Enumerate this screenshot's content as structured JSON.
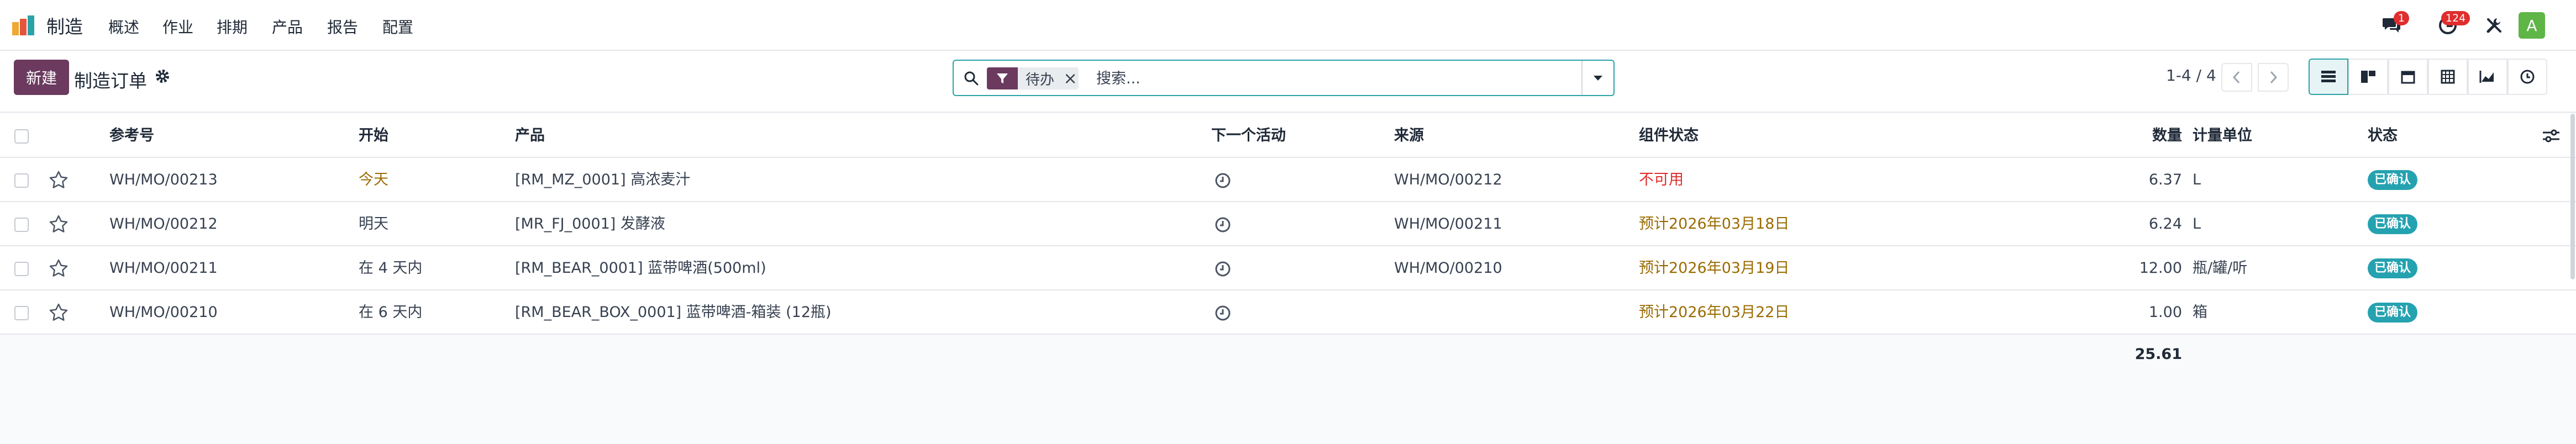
{
  "app": {
    "name": "制造"
  },
  "menu": [
    "概述",
    "作业",
    "排期",
    "产品",
    "报告",
    "配置"
  ],
  "systray": {
    "messages_count": "1",
    "activities_count": "124",
    "avatar_letter": "A"
  },
  "control": {
    "new_label": "新建",
    "title": "制造订单",
    "facet_label": "待办",
    "search_placeholder": "搜索...",
    "pager": "1-4 / 4"
  },
  "columns": {
    "ref": "参考号",
    "start": "开始",
    "product": "产品",
    "activity": "下一个活动",
    "origin": "来源",
    "components": "组件状态",
    "qty": "数量",
    "uom": "计量单位",
    "state": "状态"
  },
  "rows": [
    {
      "ref": "WH/MO/00213",
      "start": "今天",
      "product": "[RM_MZ_0001] 高浓麦汁",
      "origin": "WH/MO/00212",
      "components": "不可用",
      "qty": "6.37",
      "uom": "L",
      "state": "已确认"
    },
    {
      "ref": "WH/MO/00212",
      "start": "明天",
      "product": "[MR_FJ_0001] 发酵液",
      "origin": "WH/MO/00211",
      "components": "预计2026年03月18日",
      "qty": "6.24",
      "uom": "L",
      "state": "已确认"
    },
    {
      "ref": "WH/MO/00211",
      "start": "在 4 天内",
      "product": "[RM_BEAR_0001] 蓝带啤酒(500ml)",
      "origin": "WH/MO/00210",
      "components": "预计2026年03月19日",
      "qty": "12.00",
      "uom": "瓶/罐/听",
      "state": "已确认"
    },
    {
      "ref": "WH/MO/00210",
      "start": "在 6 天内",
      "product": "[RM_BEAR_BOX_0001] 蓝带啤酒-箱装 (12瓶)",
      "origin": "",
      "components": "预计2026年03月22日",
      "qty": "1.00",
      "uom": "箱",
      "state": "已确认"
    }
  ],
  "total_qty": "25.61",
  "colors": {
    "brand": "#6b3a5e",
    "accent": "#2aa3a8",
    "danger": "#e02d2d",
    "warning": "#9a6b00",
    "status": "#25a2b0"
  }
}
